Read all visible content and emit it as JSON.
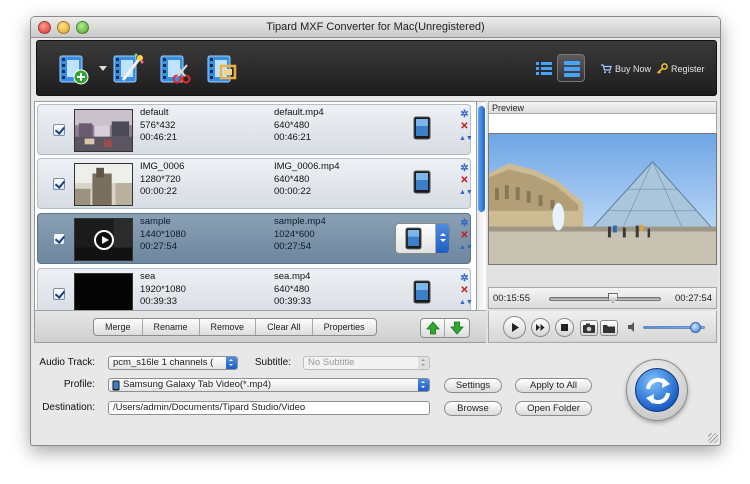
{
  "window": {
    "title": "Tipard MXF Converter for Mac(Unregistered)"
  },
  "toolbar": {
    "icons": [
      "add-file-icon",
      "edit-effect-icon",
      "clip-icon",
      "crop-icon"
    ],
    "buy_now": "Buy Now",
    "register": "Register"
  },
  "files": [
    {
      "name": "default",
      "resolution": "576*432",
      "duration": "00:46:21",
      "out_name": "default.mp4",
      "out_resolution": "640*480",
      "out_duration": "00:46:21",
      "checked": true,
      "selected": false
    },
    {
      "name": "IMG_0006",
      "resolution": "1280*720",
      "duration": "00:00:22",
      "out_name": "IMG_0006.mp4",
      "out_resolution": "640*480",
      "out_duration": "00:00:22",
      "checked": true,
      "selected": false
    },
    {
      "name": "sample",
      "resolution": "1440*1080",
      "duration": "00:27:54",
      "out_name": "sample.mp4",
      "out_resolution": "1024*600",
      "out_duration": "00:27:54",
      "checked": true,
      "selected": true
    },
    {
      "name": "sea",
      "resolution": "1920*1080",
      "duration": "00:39:33",
      "out_name": "sea.mp4",
      "out_resolution": "640*480",
      "out_duration": "00:39:33",
      "checked": true,
      "selected": false
    }
  ],
  "list_actions": {
    "merge": "Merge",
    "rename": "Rename",
    "remove": "Remove",
    "clear_all": "Clear All",
    "properties": "Properties"
  },
  "preview": {
    "label": "Preview",
    "current_time": "00:15:55",
    "total_time": "00:27:54",
    "progress": 0.57,
    "volume": 0.85
  },
  "settings": {
    "audio_track_label": "Audio Track:",
    "audio_track_value": "pcm_s16le 1 channels (",
    "subtitle_label": "Subtitle:",
    "subtitle_value": "No Subtitle",
    "profile_label": "Profile:",
    "profile_value": "Samsung Galaxy Tab Video(*.mp4)",
    "destination_label": "Destination:",
    "destination_value": "/Users/admin/Documents/Tipard Studio/Video",
    "settings_button": "Settings",
    "apply_all_button": "Apply to All",
    "browse_button": "Browse",
    "open_folder_button": "Open Folder"
  }
}
